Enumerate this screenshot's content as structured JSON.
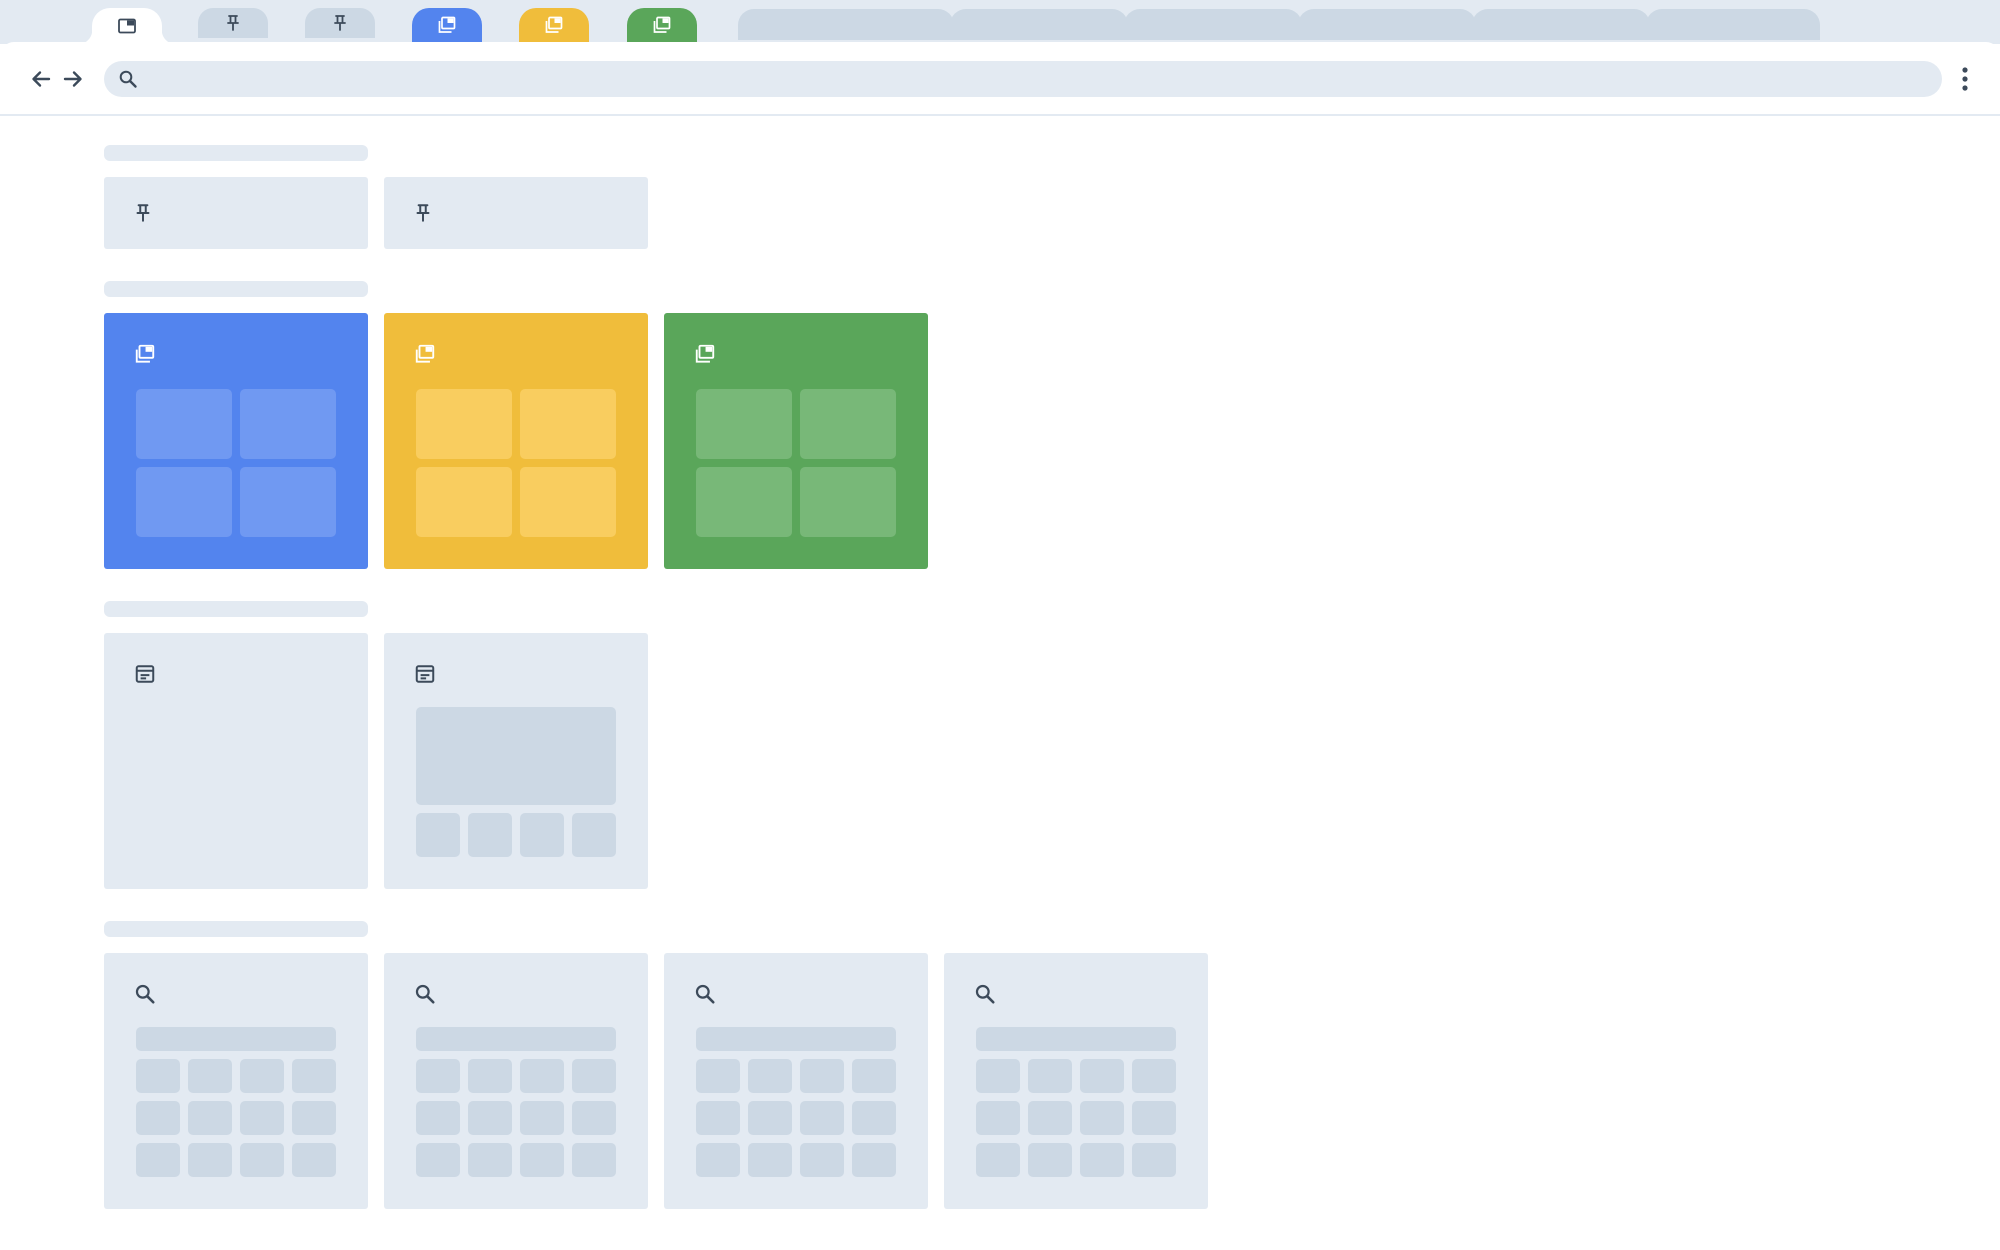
{
  "colors": {
    "chrome_background": "#e3eaf2",
    "placeholder": "#ccd8e4",
    "icon": "#3c4a5a",
    "group_blue": "#5384ee",
    "group_yellow": "#f0bd3b",
    "group_green": "#5aa65a"
  },
  "tabs": [
    {
      "kind": "active",
      "icon": "window-icon"
    },
    {
      "kind": "pinned",
      "icon": "pin-icon"
    },
    {
      "kind": "pinned",
      "icon": "pin-icon"
    },
    {
      "kind": "group",
      "color": "#5384ee",
      "icon": "tab-group-icon"
    },
    {
      "kind": "group",
      "color": "#f0bd3b",
      "icon": "tab-group-icon"
    },
    {
      "kind": "group",
      "color": "#5aa65a",
      "icon": "tab-group-icon"
    },
    {
      "kind": "placeholder"
    },
    {
      "kind": "placeholder"
    },
    {
      "kind": "placeholder"
    },
    {
      "kind": "placeholder"
    },
    {
      "kind": "placeholder"
    },
    {
      "kind": "placeholder"
    }
  ],
  "toolbar": {
    "back_icon": "arrow-left-icon",
    "forward_icon": "arrow-right-icon",
    "search_icon": "search-icon",
    "address_value": "",
    "address_placeholder": "",
    "menu_icon": "more-vert-icon"
  },
  "sections": {
    "pinned": {
      "icon": "pin-icon",
      "items": 2
    },
    "groups": {
      "icon": "tab-group-icon",
      "items": [
        {
          "color": "#5384ee",
          "tile_color": "#7099f2"
        },
        {
          "color": "#f0bd3b",
          "tile_color": "#f9cd5f"
        },
        {
          "color": "#5aa65a",
          "tile_color": "#78b878"
        }
      ]
    },
    "pages": {
      "icon": "web-page-icon",
      "items": 2
    },
    "searches": {
      "icon": "search-icon",
      "items": 4
    }
  }
}
